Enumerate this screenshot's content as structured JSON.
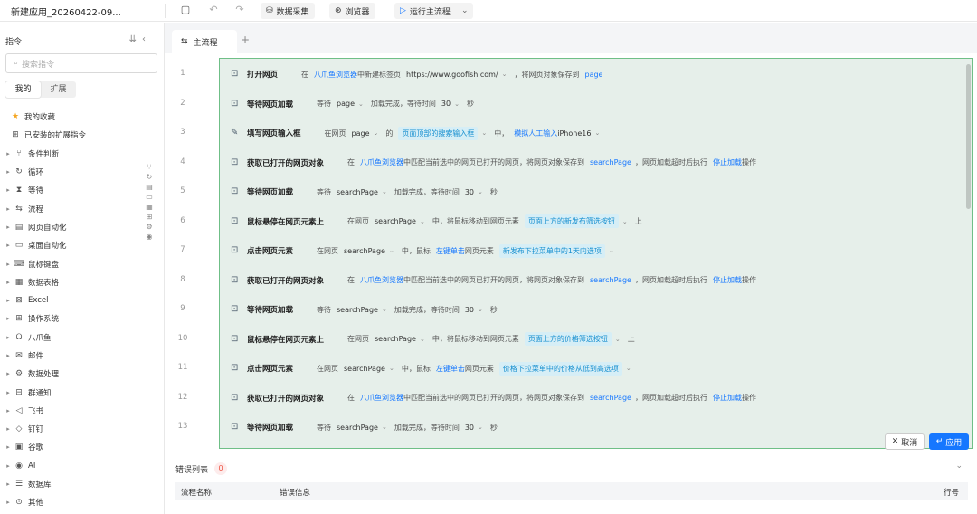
{
  "app": {
    "title": "新建应用_20260422-09..."
  },
  "toolbar": {
    "data_collect": "数据采集",
    "browser": "浏览器",
    "run_main": "运行主流程"
  },
  "sidebar": {
    "title": "指令",
    "search_placeholder": "搜索指令",
    "tabs": [
      "我的",
      "扩展"
    ],
    "favorites": "我的收藏",
    "installed": "已安装的扩展指令",
    "items": [
      "条件判断",
      "循环",
      "等待",
      "流程",
      "网页自动化",
      "桌面自动化",
      "鼠标键盘",
      "数据表格",
      "Excel",
      "操作系统",
      "八爪鱼",
      "邮件",
      "数据处理",
      "群通知",
      "飞书",
      "钉钉",
      "谷歌",
      "AI",
      "数据库",
      "其他"
    ]
  },
  "editor": {
    "tab_label": "主流程"
  },
  "steps": [
    {
      "no": "1",
      "name": "打开网页",
      "parts": [
        [
          "t",
          "在"
        ],
        [
          "link",
          "八爪鱼浏览器"
        ],
        [
          "t",
          "中新建标签页"
        ],
        [
          "var",
          "https://www.goofish.com/"
        ],
        [
          "chev",
          "⌄"
        ],
        [
          "t",
          "，将网页对象保存到"
        ],
        [
          "chip2",
          "page"
        ]
      ]
    },
    {
      "no": "2",
      "name": "等待网页加载",
      "parts": [
        [
          "t",
          "等待"
        ],
        [
          "var",
          "page"
        ],
        [
          "chev",
          "⌄"
        ],
        [
          "t",
          "加载完成，等待时间"
        ],
        [
          "var",
          "30"
        ],
        [
          "chev",
          "⌄"
        ],
        [
          "t",
          "秒"
        ]
      ]
    },
    {
      "no": "3",
      "name": "填写网页输入框",
      "parts": [
        [
          "t",
          "在网页"
        ],
        [
          "var",
          "page"
        ],
        [
          "chev",
          "⌄"
        ],
        [
          "t",
          "的"
        ],
        [
          "chip",
          "页面顶部的搜索输入框"
        ],
        [
          "chev",
          "⌄"
        ],
        [
          "t",
          "中，"
        ],
        [
          "link",
          "模拟人工输入"
        ],
        [
          "var",
          "iPhone16"
        ],
        [
          "chev",
          "⌄"
        ]
      ]
    },
    {
      "no": "4",
      "name": "获取已打开的网页对象",
      "parts": [
        [
          "t",
          "在"
        ],
        [
          "link",
          "八爪鱼浏览器"
        ],
        [
          "t",
          "中匹配当前选中的网页已打开的网页，将网页对象保存到"
        ],
        [
          "chip2",
          "searchPage"
        ],
        [
          "t",
          "，网页加载超时后执行"
        ],
        [
          "link",
          "停止加载"
        ],
        [
          "t",
          "操作"
        ]
      ]
    },
    {
      "no": "5",
      "name": "等待网页加载",
      "parts": [
        [
          "t",
          "等待"
        ],
        [
          "var",
          "searchPage"
        ],
        [
          "chev",
          "⌄"
        ],
        [
          "t",
          "加载完成，等待时间"
        ],
        [
          "var",
          "30"
        ],
        [
          "chev",
          "⌄"
        ],
        [
          "t",
          "秒"
        ]
      ]
    },
    {
      "no": "6",
      "name": "鼠标悬停在网页元素上",
      "parts": [
        [
          "t",
          "在网页"
        ],
        [
          "var",
          "searchPage"
        ],
        [
          "chev",
          "⌄"
        ],
        [
          "t",
          "中，将鼠标移动到网页元素"
        ],
        [
          "chip",
          "页面上方的新发布筛选按钮"
        ],
        [
          "chev",
          "⌄"
        ],
        [
          "t",
          "上"
        ]
      ]
    },
    {
      "no": "7",
      "name": "点击网页元素",
      "parts": [
        [
          "t",
          "在网页"
        ],
        [
          "var",
          "searchPage"
        ],
        [
          "chev",
          "⌄"
        ],
        [
          "t",
          "中，鼠标"
        ],
        [
          "link",
          "左键单击"
        ],
        [
          "t",
          "网页元素"
        ],
        [
          "chip",
          "新发布下拉菜单中的1天内选项"
        ],
        [
          "chev",
          "⌄"
        ]
      ]
    },
    {
      "no": "8",
      "name": "获取已打开的网页对象",
      "parts": [
        [
          "t",
          "在"
        ],
        [
          "link",
          "八爪鱼浏览器"
        ],
        [
          "t",
          "中匹配当前选中的网页已打开的网页，将网页对象保存到"
        ],
        [
          "chip2",
          "searchPage"
        ],
        [
          "t",
          "，网页加载超时后执行"
        ],
        [
          "link",
          "停止加载"
        ],
        [
          "t",
          "操作"
        ]
      ]
    },
    {
      "no": "9",
      "name": "等待网页加载",
      "parts": [
        [
          "t",
          "等待"
        ],
        [
          "var",
          "searchPage"
        ],
        [
          "chev",
          "⌄"
        ],
        [
          "t",
          "加载完成，等待时间"
        ],
        [
          "var",
          "30"
        ],
        [
          "chev",
          "⌄"
        ],
        [
          "t",
          "秒"
        ]
      ]
    },
    {
      "no": "10",
      "name": "鼠标悬停在网页元素上",
      "parts": [
        [
          "t",
          "在网页"
        ],
        [
          "var",
          "searchPage"
        ],
        [
          "chev",
          "⌄"
        ],
        [
          "t",
          "中，将鼠标移动到网页元素"
        ],
        [
          "chip",
          "页面上方的价格筛选按钮"
        ],
        [
          "chev",
          "⌄"
        ],
        [
          "t",
          "上"
        ]
      ]
    },
    {
      "no": "11",
      "name": "点击网页元素",
      "parts": [
        [
          "t",
          "在网页"
        ],
        [
          "var",
          "searchPage"
        ],
        [
          "chev",
          "⌄"
        ],
        [
          "t",
          "中，鼠标"
        ],
        [
          "link",
          "左键单击"
        ],
        [
          "t",
          "网页元素"
        ],
        [
          "chip",
          "价格下拉菜单中的价格从低到高选项"
        ],
        [
          "chev",
          "⌄"
        ]
      ]
    },
    {
      "no": "12",
      "name": "获取已打开的网页对象",
      "parts": [
        [
          "t",
          "在"
        ],
        [
          "link",
          "八爪鱼浏览器"
        ],
        [
          "t",
          "中匹配当前选中的网页已打开的网页，将网页对象保存到"
        ],
        [
          "chip2",
          "searchPage"
        ],
        [
          "t",
          "，网页加载超时后执行"
        ],
        [
          "link",
          "停止加载"
        ],
        [
          "t",
          "操作"
        ]
      ]
    },
    {
      "no": "13",
      "name": "等待网页加载",
      "parts": [
        [
          "t",
          "等待"
        ],
        [
          "var",
          "searchPage"
        ],
        [
          "chev",
          "⌄"
        ],
        [
          "t",
          "加载完成，等待时间"
        ],
        [
          "var",
          "30"
        ],
        [
          "chev",
          "⌄"
        ],
        [
          "t",
          "秒"
        ]
      ]
    }
  ],
  "actions": {
    "cancel": "取消",
    "apply": "应用"
  },
  "errors": {
    "title": "错误列表",
    "count": "0",
    "col_flow": "流程名称",
    "col_msg": "错误信息",
    "col_line": "行号"
  }
}
